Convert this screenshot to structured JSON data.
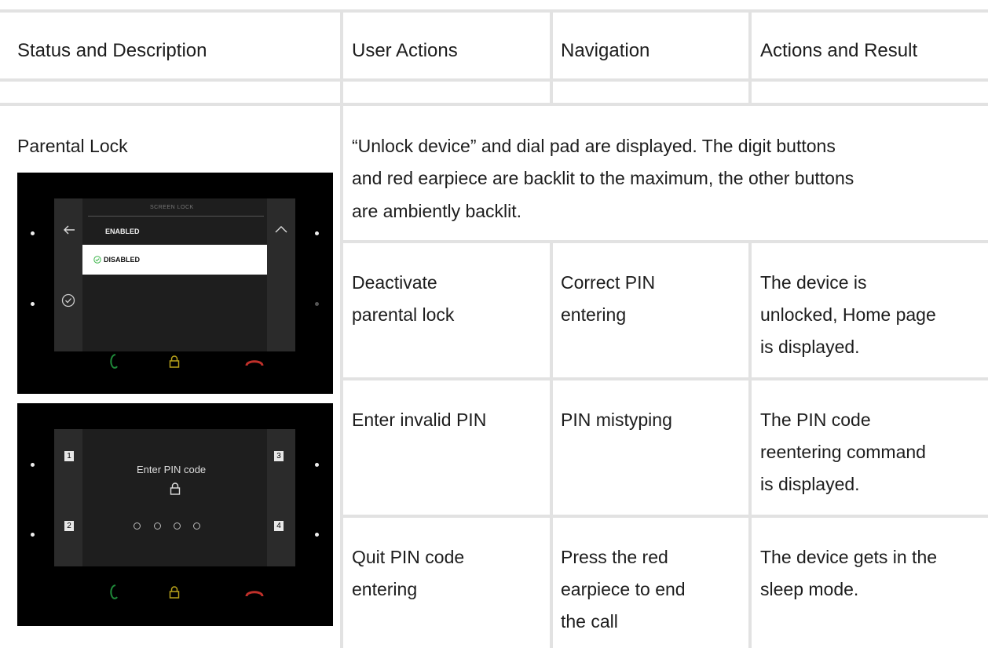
{
  "table": {
    "headers": [
      "Status and Description",
      "User Actions",
      "Navigation",
      "Actions and Result"
    ],
    "section_title": "Parental Lock",
    "description_lines": [
      "“Unlock device” and dial pad are displayed. The digit buttons",
      "and red earpiece are backlit to the maximum, the other buttons",
      "are ambiently backlit."
    ],
    "rows": [
      {
        "action": [
          "Deactivate",
          "parental lock"
        ],
        "navigation": [
          "Correct PIN",
          "entering"
        ],
        "result": [
          "The device is",
          "unlocked, Home page",
          "is displayed."
        ]
      },
      {
        "action": [
          "Enter invalid PIN"
        ],
        "navigation": [
          "PIN mistyping"
        ],
        "result": [
          "The PIN code",
          "reentering command",
          "is displayed."
        ]
      },
      {
        "action": [
          "Quit PIN code",
          "entering"
        ],
        "navigation": [
          "Press the red",
          "earpiece to end",
          "the call"
        ],
        "result": [
          "The device gets in the",
          "sleep mode."
        ]
      }
    ]
  },
  "screen1": {
    "title": "SCREEN LOCK",
    "option_enabled": "ENABLED",
    "option_disabled": "DISABLED"
  },
  "screen2": {
    "prompt": "Enter PIN code",
    "keys": [
      "1",
      "2",
      "3",
      "4"
    ]
  },
  "colors": {
    "call_green": "#1f8a3a",
    "lock_yellow": "#b8a21b",
    "hangup_red": "#c0302a",
    "check_green": "#3cb54a"
  }
}
